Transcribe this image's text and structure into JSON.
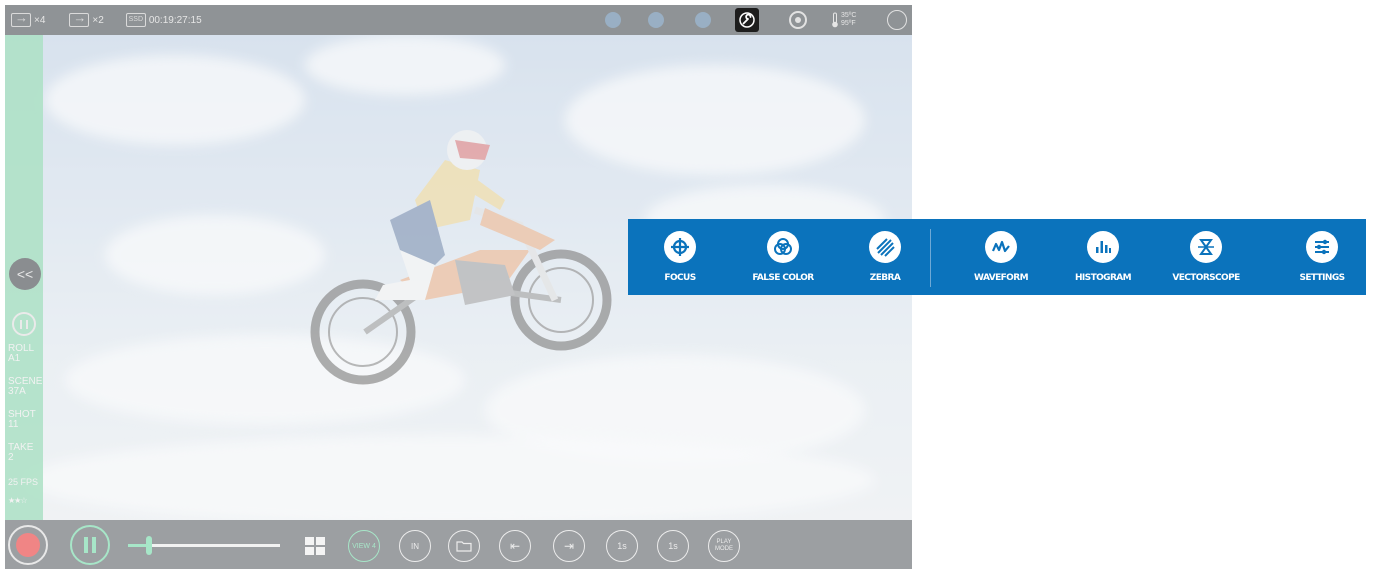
{
  "topbar": {
    "input1_count": "×4",
    "input2_count": "×2",
    "ssd_label": "SSD",
    "timecode": "00:19:27:15",
    "temp_c": "35ºC",
    "temp_f": "95ºF",
    "icons": [
      "input-icon",
      "output-icon",
      "ssd-icon",
      "headphones-icon",
      "camera-icon",
      "share-icon",
      "wrench-icon",
      "record-target-icon",
      "thermometer-icon",
      "focus-ring-icon"
    ]
  },
  "sidebar": {
    "collapse_label": "<<",
    "meta": {
      "roll_label": "ROLL",
      "roll_value": "A1",
      "scene_label": "SCENE",
      "scene_value": "37A",
      "shot_label": "SHOT",
      "shot_value": "11",
      "take_label": "TAKE",
      "take_value": "2",
      "fps": "25 FPS"
    },
    "rating": "★★☆"
  },
  "bottombar": {
    "view_label": "VIEW 4",
    "in_label": "IN",
    "skip_back_label": "1s",
    "skip_fwd_label": "1s",
    "play_mode_label": "PLAY MODE",
    "slider_position": 0.14
  },
  "palette": {
    "items": [
      {
        "label": "FOCUS",
        "icon": "crosshair-icon"
      },
      {
        "label": "FALSE COLOR",
        "icon": "rgb-circles-icon"
      },
      {
        "label": "ZEBRA",
        "icon": "zebra-stripes-icon"
      },
      {
        "label": "WAVEFORM",
        "icon": "waveform-icon"
      },
      {
        "label": "HISTOGRAM",
        "icon": "histogram-icon"
      },
      {
        "label": "VECTORSCOPE",
        "icon": "vectorscope-icon"
      },
      {
        "label": "SETTINGS",
        "icon": "sliders-icon"
      }
    ],
    "background": "#0b73bc"
  },
  "colors": {
    "accent_green": "#a7e6c8",
    "record_red": "#f08585"
  }
}
